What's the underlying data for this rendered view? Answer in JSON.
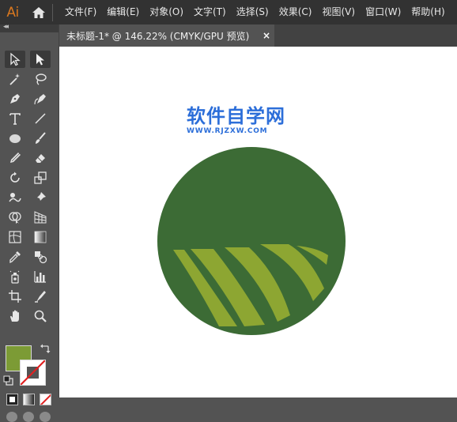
{
  "app": {
    "logo_text": "Ai"
  },
  "menu": {
    "items": [
      {
        "label": "文件(F)"
      },
      {
        "label": "编辑(E)"
      },
      {
        "label": "对象(O)"
      },
      {
        "label": "文字(T)"
      },
      {
        "label": "选择(S)"
      },
      {
        "label": "效果(C)"
      },
      {
        "label": "视图(V)"
      },
      {
        "label": "窗口(W)"
      },
      {
        "label": "帮助(H)"
      }
    ]
  },
  "document_tab": {
    "title": "未标题-1* @ 146.22% (CMYK/GPU 预览)",
    "close_symbol": "×"
  },
  "toolbar": {
    "collapse_symbol": "◂◂",
    "tools": [
      {
        "name": "selection-tool",
        "icon": "arrow-outline"
      },
      {
        "name": "direct-selection-tool",
        "icon": "arrow-solid"
      },
      {
        "name": "magic-wand-tool",
        "icon": "magic-wand"
      },
      {
        "name": "lasso-tool",
        "icon": "lasso"
      },
      {
        "name": "pen-tool",
        "icon": "pen"
      },
      {
        "name": "curvature-tool",
        "icon": "curvature-pen"
      },
      {
        "name": "type-tool",
        "icon": "type"
      },
      {
        "name": "line-tool",
        "icon": "line"
      },
      {
        "name": "ellipse-tool",
        "icon": "ellipse"
      },
      {
        "name": "paintbrush-tool",
        "icon": "brush"
      },
      {
        "name": "pencil-tool",
        "icon": "pencil"
      },
      {
        "name": "eraser-tool",
        "icon": "eraser"
      },
      {
        "name": "rotate-tool",
        "icon": "rotate"
      },
      {
        "name": "scale-tool",
        "icon": "scale"
      },
      {
        "name": "warp-tool",
        "icon": "warp"
      },
      {
        "name": "puppet-warp-tool",
        "icon": "pin"
      },
      {
        "name": "shape-builder-tool",
        "icon": "shape-builder"
      },
      {
        "name": "perspective-grid-tool",
        "icon": "perspective"
      },
      {
        "name": "mesh-tool",
        "icon": "mesh"
      },
      {
        "name": "gradient-tool",
        "icon": "gradient"
      },
      {
        "name": "eyedropper-tool",
        "icon": "eyedropper"
      },
      {
        "name": "blend-tool",
        "icon": "blend"
      },
      {
        "name": "symbol-sprayer-tool",
        "icon": "symbol-sprayer"
      },
      {
        "name": "column-graph-tool",
        "icon": "bar-graph"
      },
      {
        "name": "artboard-tool",
        "icon": "artboard"
      },
      {
        "name": "slice-tool",
        "icon": "slice"
      },
      {
        "name": "hand-tool",
        "icon": "hand"
      },
      {
        "name": "zoom-tool",
        "icon": "zoom"
      }
    ],
    "fill_color": "#7c9b35",
    "stroke": "none"
  },
  "canvas": {
    "watermark_title": "软件自学网",
    "watermark_url": "WWW.RJZXW.COM",
    "watermark_color": "#2c6ed9",
    "circle_color": "#3c6b35",
    "stripe_color": "#8da632"
  }
}
